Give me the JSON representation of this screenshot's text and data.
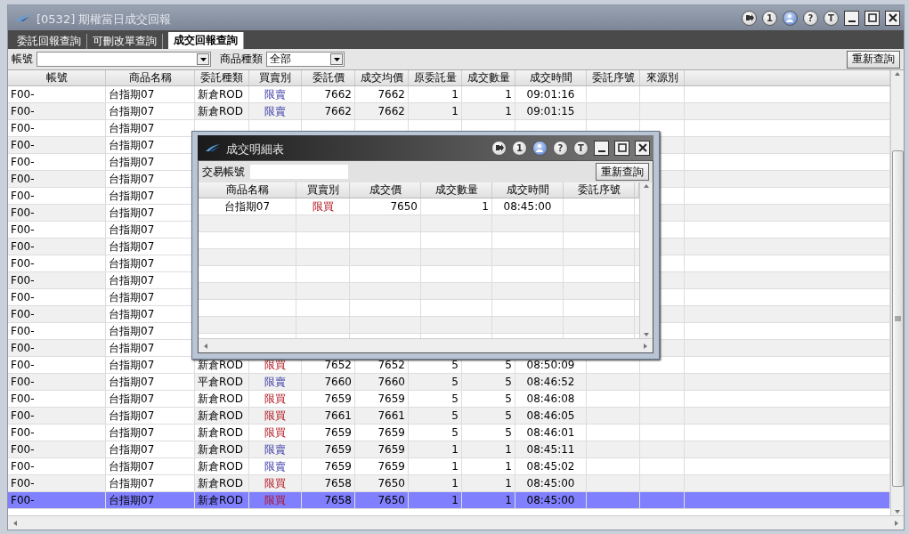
{
  "window": {
    "title": "[0532] 期權當日成交回報",
    "tool_buttons": [
      {
        "kind": "exit"
      },
      {
        "kind": "text",
        "label": "1"
      },
      {
        "kind": "user"
      },
      {
        "kind": "text",
        "label": "?"
      },
      {
        "kind": "text",
        "label": "T"
      }
    ]
  },
  "tabs": [
    {
      "label": "委託回報查詢",
      "selected": false
    },
    {
      "label": "可刪改單查詢",
      "selected": false
    },
    {
      "label": "成交回報查詢",
      "selected": true
    }
  ],
  "filter": {
    "account_label": "帳號",
    "product_type_label": "商品種類",
    "product_type_value": "全部",
    "requery_button": "重新查詢"
  },
  "table": {
    "columns": [
      "帳號",
      "商品名稱",
      "委託種類",
      "買賣別",
      "委託價",
      "成交均價",
      "原委託量",
      "成交數量",
      "成交時間",
      "委託序號",
      "來源別"
    ],
    "rows": [
      {
        "account": "F00-",
        "product": "台指期07",
        "order_type": "新倉ROD",
        "side": "限賣",
        "kind": "sell",
        "price": "7662",
        "avg_price": "7662",
        "orig_qty": "1",
        "filled_qty": "1",
        "time": "09:01:16",
        "selected": false
      },
      {
        "account": "F00-",
        "product": "台指期07",
        "order_type": "新倉ROD",
        "side": "限賣",
        "kind": "sell",
        "price": "7662",
        "avg_price": "7662",
        "orig_qty": "1",
        "filled_qty": "1",
        "time": "09:01:15",
        "selected": false
      },
      {
        "account": "F00-",
        "product": "台指期07",
        "selected": false
      },
      {
        "account": "F00-",
        "product": "台指期07",
        "selected": false
      },
      {
        "account": "F00-",
        "product": "台指期07",
        "selected": false
      },
      {
        "account": "F00-",
        "product": "台指期07",
        "selected": false
      },
      {
        "account": "F00-",
        "product": "台指期07",
        "selected": false
      },
      {
        "account": "F00-",
        "product": "台指期07",
        "selected": false
      },
      {
        "account": "F00-",
        "product": "台指期07",
        "selected": false
      },
      {
        "account": "F00-",
        "product": "台指期07",
        "selected": false
      },
      {
        "account": "F00-",
        "product": "台指期07",
        "selected": false
      },
      {
        "account": "F00-",
        "product": "台指期07",
        "selected": false
      },
      {
        "account": "F00-",
        "product": "台指期07",
        "selected": false
      },
      {
        "account": "F00-",
        "product": "台指期07",
        "selected": false
      },
      {
        "account": "F00-",
        "product": "台指期07",
        "selected": false
      },
      {
        "account": "F00-",
        "product": "台指期07",
        "selected": false
      },
      {
        "account": "F00-",
        "product": "台指期07",
        "order_type": "新倉ROD",
        "side": "限買",
        "kind": "buy",
        "price": "7652",
        "avg_price": "7652",
        "orig_qty": "5",
        "filled_qty": "5",
        "time": "08:50:09",
        "selected": false
      },
      {
        "account": "F00-",
        "product": "台指期07",
        "order_type": "平倉ROD",
        "side": "限賣",
        "kind": "sell",
        "price": "7660",
        "avg_price": "7660",
        "orig_qty": "5",
        "filled_qty": "5",
        "time": "08:46:52",
        "selected": false
      },
      {
        "account": "F00-",
        "product": "台指期07",
        "order_type": "新倉ROD",
        "side": "限買",
        "kind": "buy",
        "price": "7659",
        "avg_price": "7659",
        "orig_qty": "5",
        "filled_qty": "5",
        "time": "08:46:08",
        "selected": false
      },
      {
        "account": "F00-",
        "product": "台指期07",
        "order_type": "新倉ROD",
        "side": "限買",
        "kind": "buy",
        "price": "7661",
        "avg_price": "7661",
        "orig_qty": "5",
        "filled_qty": "5",
        "time": "08:46:05",
        "selected": false
      },
      {
        "account": "F00-",
        "product": "台指期07",
        "order_type": "新倉ROD",
        "side": "限買",
        "kind": "buy",
        "price": "7659",
        "avg_price": "7659",
        "orig_qty": "5",
        "filled_qty": "5",
        "time": "08:46:01",
        "selected": false
      },
      {
        "account": "F00-",
        "product": "台指期07",
        "order_type": "新倉ROD",
        "side": "限賣",
        "kind": "sell",
        "price": "7659",
        "avg_price": "7659",
        "orig_qty": "1",
        "filled_qty": "1",
        "time": "08:45:11",
        "selected": false
      },
      {
        "account": "F00-",
        "product": "台指期07",
        "order_type": "新倉ROD",
        "side": "限賣",
        "kind": "sell",
        "price": "7659",
        "avg_price": "7659",
        "orig_qty": "1",
        "filled_qty": "1",
        "time": "08:45:02",
        "selected": false
      },
      {
        "account": "F00-",
        "product": "台指期07",
        "order_type": "新倉ROD",
        "side": "限買",
        "kind": "buy",
        "price": "7658",
        "avg_price": "7650",
        "orig_qty": "1",
        "filled_qty": "1",
        "time": "08:45:00",
        "selected": false
      },
      {
        "account": "F00-",
        "product": "台指期07",
        "order_type": "新倉ROD",
        "side": "限買",
        "kind": "buy",
        "price": "7658",
        "avg_price": "7650",
        "orig_qty": "1",
        "filled_qty": "1",
        "time": "08:45:00",
        "selected": true
      }
    ]
  },
  "detail_window": {
    "title": "成交明細表",
    "tool_buttons": [
      {
        "kind": "exit"
      },
      {
        "kind": "text",
        "label": "1"
      },
      {
        "kind": "user"
      },
      {
        "kind": "text",
        "label": "?"
      },
      {
        "kind": "text",
        "label": "T"
      }
    ],
    "account_label": "交易帳號",
    "requery_button": "重新查詢",
    "columns": [
      "商品名稱",
      "買賣別",
      "成交價",
      "成交數量",
      "成交時間",
      "委託序號"
    ],
    "rows": [
      {
        "product": "台指期07",
        "side": "限買",
        "kind": "buy",
        "price": "7650",
        "qty": "1",
        "time": "08:45:00"
      }
    ]
  }
}
